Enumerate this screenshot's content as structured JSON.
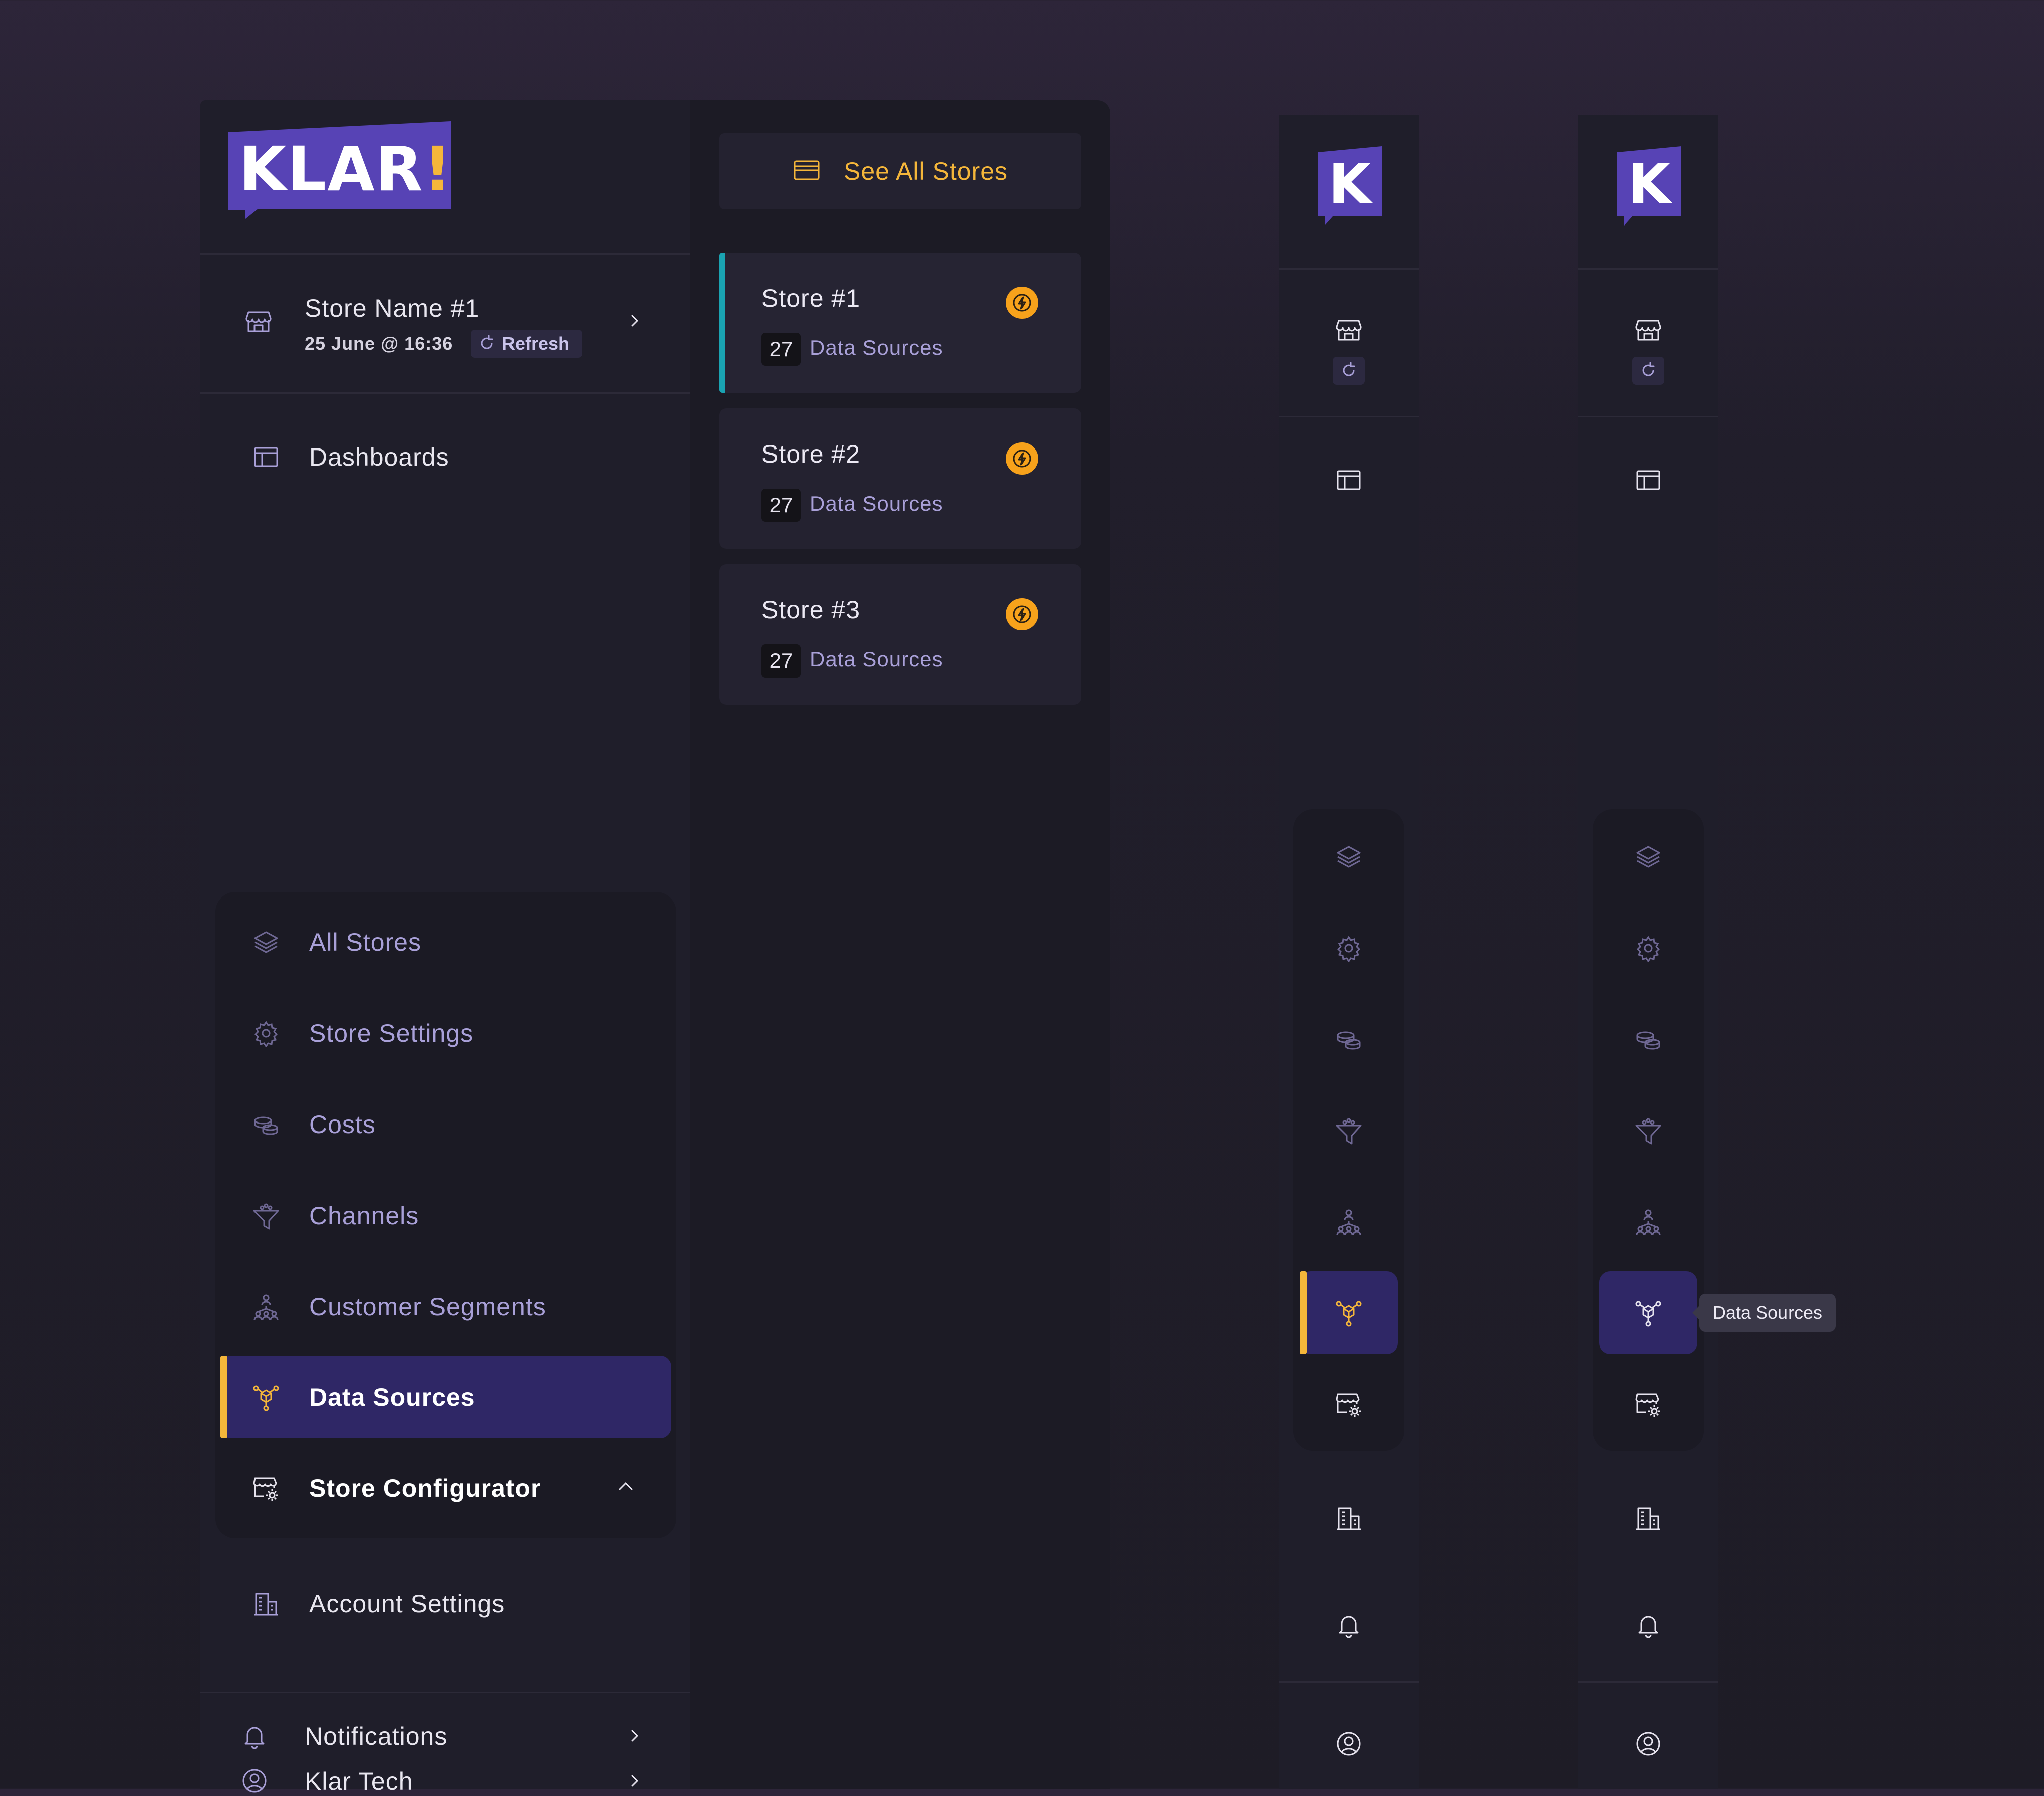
{
  "brand": {
    "logo_text": "KLAR",
    "logo_exclamation": "!",
    "mini_logo_text": "K",
    "logo_color": "#5743b5",
    "accent_color": "#f4b63a"
  },
  "store_header": {
    "name": "Store Name #1",
    "timestamp": "25 June @ 16:36",
    "refresh_label": "Refresh"
  },
  "nav": {
    "dashboards": "Dashboards",
    "group_items": [
      {
        "label": "All Stores",
        "icon": "layers-icon"
      },
      {
        "label": "Store Settings",
        "icon": "gear-icon"
      },
      {
        "label": "Costs",
        "icon": "coins-icon"
      },
      {
        "label": "Channels",
        "icon": "funnel-icon"
      },
      {
        "label": "Customer Segments",
        "icon": "segments-icon"
      },
      {
        "label": "Data Sources",
        "icon": "data-sources-icon",
        "active": true
      },
      {
        "label": "Store Configurator",
        "icon": "store-config-icon"
      }
    ],
    "account_settings": "Account Settings",
    "notifications": "Notifications",
    "account": "Klar Tech"
  },
  "stores_panel": {
    "see_all_label": "See All Stores",
    "stores": [
      {
        "name": "Store #1",
        "count": "27",
        "count_label": "Data Sources",
        "selected": true
      },
      {
        "name": "Store #2",
        "count": "27",
        "count_label": "Data Sources",
        "selected": false
      },
      {
        "name": "Store #3",
        "count": "27",
        "count_label": "Data Sources",
        "selected": false
      }
    ]
  },
  "tooltip": {
    "label": "Data Sources"
  }
}
